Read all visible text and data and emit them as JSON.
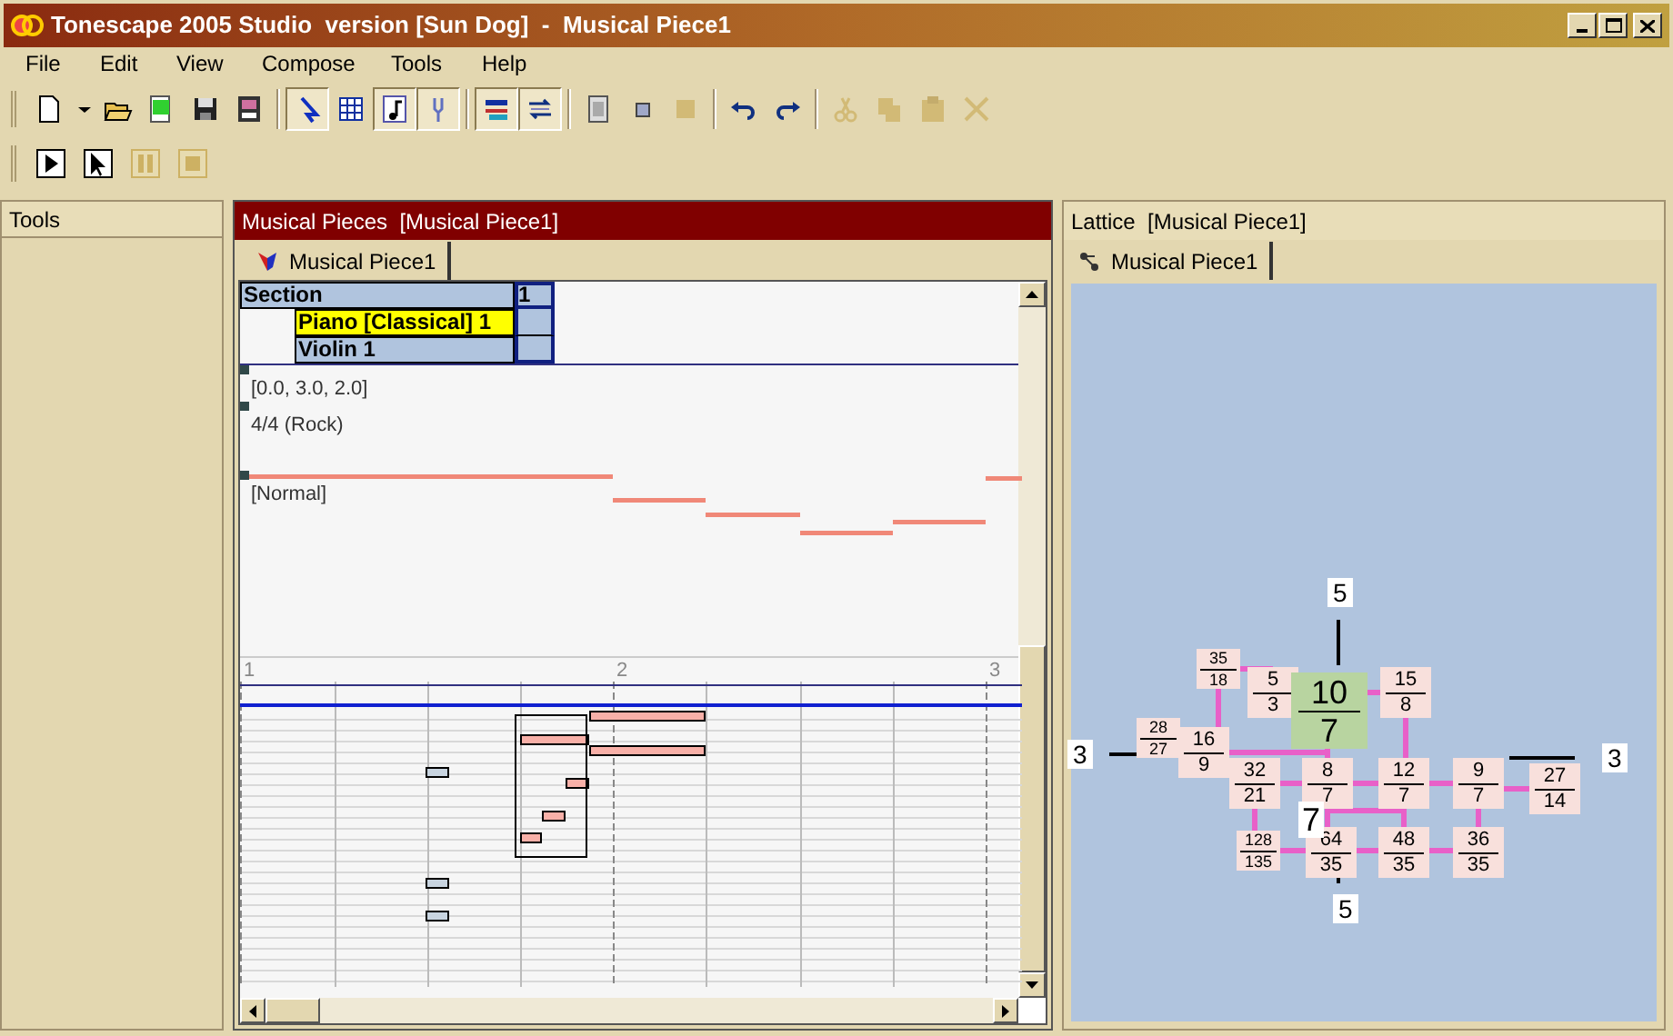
{
  "window": {
    "title": "Tonescape 2005 Studio  version [Sun Dog]  -  Musical Piece1"
  },
  "menu": [
    "File",
    "Edit",
    "View",
    "Compose",
    "Tools",
    "Help"
  ],
  "toolbar": [
    {
      "kind": "new",
      "pressed": false,
      "disabled": false
    },
    {
      "kind": "dropdown",
      "pressed": false,
      "disabled": false
    },
    {
      "kind": "open",
      "pressed": false,
      "disabled": false
    },
    {
      "kind": "sheet",
      "pressed": false,
      "disabled": false
    },
    {
      "kind": "save",
      "pressed": false,
      "disabled": false
    },
    {
      "kind": "props",
      "pressed": false,
      "disabled": false
    },
    {
      "kind": "sep"
    },
    {
      "kind": "pointer",
      "pressed": true,
      "disabled": false
    },
    {
      "kind": "grid",
      "pressed": false,
      "disabled": false
    },
    {
      "kind": "note",
      "pressed": true,
      "disabled": false
    },
    {
      "kind": "fork",
      "pressed": true,
      "disabled": false
    },
    {
      "kind": "sep"
    },
    {
      "kind": "bars",
      "pressed": true,
      "disabled": false
    },
    {
      "kind": "swap",
      "pressed": true,
      "disabled": false
    },
    {
      "kind": "sep"
    },
    {
      "kind": "page",
      "pressed": false,
      "disabled": false
    },
    {
      "kind": "smallsquare",
      "pressed": false,
      "disabled": false
    },
    {
      "kind": "square",
      "pressed": false,
      "disabled": true
    },
    {
      "kind": "sep"
    },
    {
      "kind": "undo",
      "pressed": false,
      "disabled": false
    },
    {
      "kind": "redo",
      "pressed": false,
      "disabled": false
    },
    {
      "kind": "sep"
    },
    {
      "kind": "cut",
      "pressed": false,
      "disabled": true
    },
    {
      "kind": "copy",
      "pressed": false,
      "disabled": true
    },
    {
      "kind": "paste",
      "pressed": false,
      "disabled": true
    },
    {
      "kind": "delete",
      "pressed": false,
      "disabled": true
    }
  ],
  "transport": [
    {
      "kind": "play",
      "disabled": false
    },
    {
      "kind": "select",
      "disabled": false
    },
    {
      "kind": "pause",
      "disabled": true
    },
    {
      "kind": "stop",
      "disabled": true
    }
  ],
  "tools_panel": {
    "title": "Tools"
  },
  "pieces_panel": {
    "title": "Musical Pieces  [Musical Piece1]",
    "tabs": [
      {
        "label": "Musical Piece1",
        "selected": true
      }
    ],
    "section_table": {
      "columns": [
        "Section",
        "1"
      ],
      "rows": [
        {
          "label": "Piano [Classical] 1",
          "selected": true
        },
        {
          "label": "Violin 1",
          "selected": false
        }
      ]
    },
    "tracks": [
      "[0.0, 3.0, 2.0]",
      "4/4 (Rock)",
      "[Normal]"
    ],
    "ruler": [
      "1",
      "2",
      "3"
    ]
  },
  "lattice_panel": {
    "title": "Lattice  [Musical Piece1]",
    "tabs": [
      {
        "label": "Musical Piece1",
        "selected": true
      }
    ],
    "axis_labels": [
      "5",
      "3",
      "3",
      "5"
    ],
    "nodes": [
      {
        "num": "35",
        "den": "18",
        "kind": "small"
      },
      {
        "num": "5",
        "den": "3",
        "kind": "normal"
      },
      {
        "num": "15",
        "den": "8",
        "kind": "normal"
      },
      {
        "num": "28",
        "den": "27",
        "kind": "small"
      },
      {
        "num": "16",
        "den": "9",
        "kind": "normal"
      },
      {
        "num": "32",
        "den": "21",
        "kind": "normal"
      },
      {
        "num": "8",
        "den": "7",
        "kind": "normal"
      },
      {
        "num": "12",
        "den": "7",
        "kind": "normal"
      },
      {
        "num": "9",
        "den": "7",
        "kind": "normal"
      },
      {
        "num": "27",
        "den": "14",
        "kind": "normal"
      },
      {
        "num": "128",
        "den": "135",
        "kind": "small"
      },
      {
        "num": "64",
        "den": "35",
        "kind": "normal"
      },
      {
        "num": "48",
        "den": "35",
        "kind": "normal"
      },
      {
        "num": "36",
        "den": "35",
        "kind": "normal"
      },
      {
        "num": "10",
        "den": "7",
        "kind": "center"
      }
    ],
    "note_label": "7"
  }
}
